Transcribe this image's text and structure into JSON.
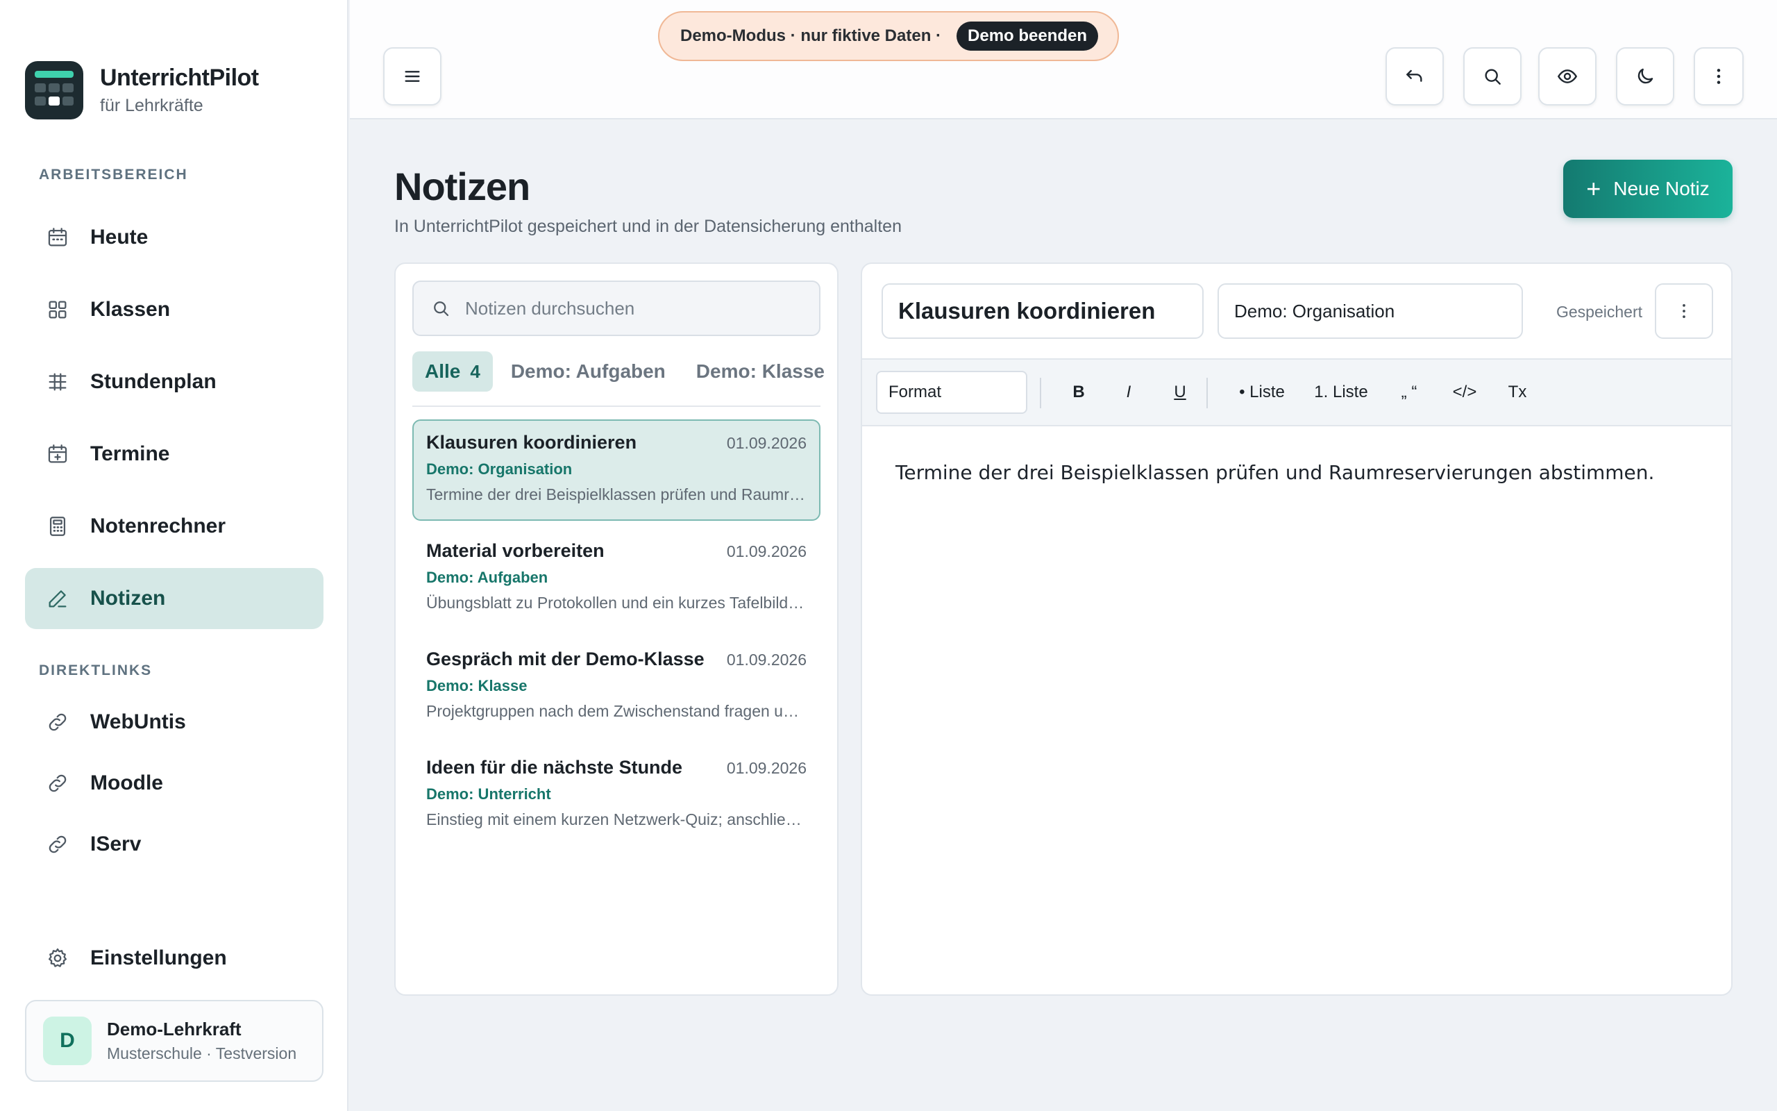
{
  "brand": {
    "title": "UnterrichtPilot",
    "subtitle": "für Lehrkräfte"
  },
  "sidebar": {
    "workspace_label": "ARBEITSBEREICH",
    "items": [
      {
        "label": "Heute",
        "icon": "calendar-icon"
      },
      {
        "label": "Klassen",
        "icon": "grid-icon"
      },
      {
        "label": "Stundenplan",
        "icon": "timetable-icon"
      },
      {
        "label": "Termine",
        "icon": "calendar-plus-icon"
      },
      {
        "label": "Notenrechner",
        "icon": "calculator-icon"
      },
      {
        "label": "Notizen",
        "icon": "pen-icon",
        "active": true
      }
    ],
    "links_label": "DIREKTLINKS",
    "links": [
      {
        "label": "WebUntis",
        "icon": "link-icon"
      },
      {
        "label": "Moodle",
        "icon": "link-icon"
      },
      {
        "label": "IServ",
        "icon": "link-icon"
      }
    ],
    "settings_label": "Einstellungen",
    "user": {
      "initial": "D",
      "name": "Demo-Lehrkraft",
      "subtitle": "Musterschule · Testversion"
    }
  },
  "topbar": {
    "demo_text": "Demo-Modus · nur fiktive Daten ·",
    "demo_exit": "Demo beenden"
  },
  "page": {
    "title": "Notizen",
    "subtitle": "In UnterrichtPilot gespeichert und in der Datensicherung enthalten",
    "new_note_label": "Neue Notiz"
  },
  "list": {
    "search_placeholder": "Notizen durchsuchen",
    "filters": [
      {
        "label": "Alle",
        "count": "4",
        "active": true
      },
      {
        "label": "Demo: Aufgaben"
      },
      {
        "label": "Demo: Klasse"
      }
    ],
    "notes": [
      {
        "title": "Klausuren koordinieren",
        "date": "01.09.2026",
        "category": "Demo: Organisation",
        "preview": "Termine der drei Beispielklassen prüfen und Raumreservierungen abstimmen.",
        "active": true
      },
      {
        "title": "Material vorbereiten",
        "date": "01.09.2026",
        "category": "Demo: Aufgaben",
        "preview": "Übungsblatt zu Protokollen und ein kurzes Tafelbild vorbereiten."
      },
      {
        "title": "Gespräch mit der Demo-Klasse",
        "date": "01.09.2026",
        "category": "Demo: Klasse",
        "preview": "Projektgruppen nach dem Zwischenstand fragen und Termine festlegen."
      },
      {
        "title": "Ideen für die nächste Stunde",
        "date": "01.09.2026",
        "category": "Demo: Unterricht",
        "preview": "Einstieg mit einem kurzen Netzwerk-Quiz; anschließend Gruppenarbeit."
      }
    ]
  },
  "editor": {
    "title": "Klausuren koordinieren",
    "category": "Demo: Organisation",
    "status": "Gespeichert",
    "toolbar": {
      "format": "Format",
      "bold": "B",
      "italic": "I",
      "underline": "U",
      "bullet_list": "• Liste",
      "numbered_list": "1. Liste",
      "quote": "„ “",
      "code": "</>",
      "clear": "Tx"
    },
    "body": "Termine der drei Beispielklassen prüfen und Raumreservierungen abstimmen."
  }
}
